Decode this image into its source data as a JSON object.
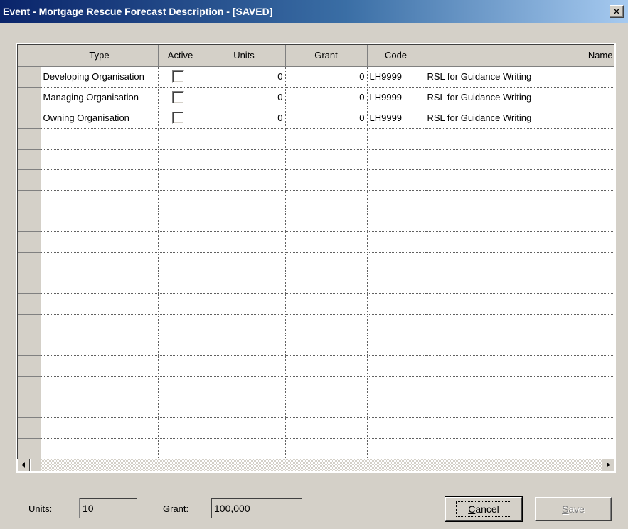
{
  "window": {
    "title": "Event - Mortgage Rescue Forecast Description - [SAVED]",
    "close_glyph": "✕"
  },
  "grid": {
    "columns": [
      "Type",
      "Active",
      "Units",
      "Grant",
      "Code",
      "Name"
    ],
    "rows": [
      {
        "type": "Developing Organisation",
        "active": false,
        "units": "0",
        "grant": "0",
        "code": "LH9999",
        "name": "RSL for Guidance Writing"
      },
      {
        "type": "Managing Organisation",
        "active": false,
        "units": "0",
        "grant": "0",
        "code": "LH9999",
        "name": "RSL for Guidance Writing"
      },
      {
        "type": "Owning Organisation",
        "active": false,
        "units": "0",
        "grant": "0",
        "code": "LH9999",
        "name": "RSL for Guidance Writing"
      }
    ],
    "empty_row_count": 16
  },
  "footer": {
    "units_label": "Units:",
    "units_value": "10",
    "grant_label": "Grant:",
    "grant_value": "100,000",
    "cancel_hotkey": "C",
    "cancel_rest": "ancel",
    "save_hotkey": "S",
    "save_rest": "ave"
  }
}
